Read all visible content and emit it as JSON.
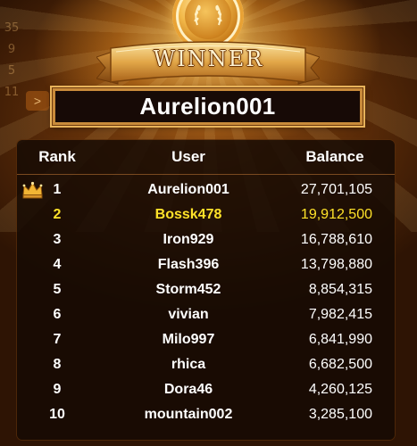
{
  "background": {
    "digits": [
      "35",
      "9",
      "5",
      "11"
    ],
    "arrow_glyph": ">"
  },
  "banner": {
    "title": "WINNER",
    "winner_name": "Aurelion001"
  },
  "leaderboard": {
    "headers": {
      "rank": "Rank",
      "user": "User",
      "balance": "Balance"
    },
    "rows": [
      {
        "rank": "1",
        "user": "Aurelion001",
        "balance": "27,701,105",
        "crown": true,
        "highlight": false
      },
      {
        "rank": "2",
        "user": "Bossk478",
        "balance": "19,912,500",
        "crown": false,
        "highlight": true
      },
      {
        "rank": "3",
        "user": "Iron929",
        "balance": "16,788,610",
        "crown": false,
        "highlight": false
      },
      {
        "rank": "4",
        "user": "Flash396",
        "balance": "13,798,880",
        "crown": false,
        "highlight": false
      },
      {
        "rank": "5",
        "user": "Storm452",
        "balance": "8,854,315",
        "crown": false,
        "highlight": false
      },
      {
        "rank": "6",
        "user": "vivian",
        "balance": "7,982,415",
        "crown": false,
        "highlight": false
      },
      {
        "rank": "7",
        "user": "Milo997",
        "balance": "6,841,990",
        "crown": false,
        "highlight": false
      },
      {
        "rank": "8",
        "user": "rhica",
        "balance": "6,682,500",
        "crown": false,
        "highlight": false
      },
      {
        "rank": "9",
        "user": "Dora46",
        "balance": "4,260,125",
        "crown": false,
        "highlight": false
      },
      {
        "rank": "10",
        "user": "mountain002",
        "balance": "3,285,100",
        "crown": false,
        "highlight": false
      }
    ]
  },
  "colors": {
    "highlight": "#ffe229",
    "text": "#ffffff",
    "gold": "#e8b35a"
  }
}
